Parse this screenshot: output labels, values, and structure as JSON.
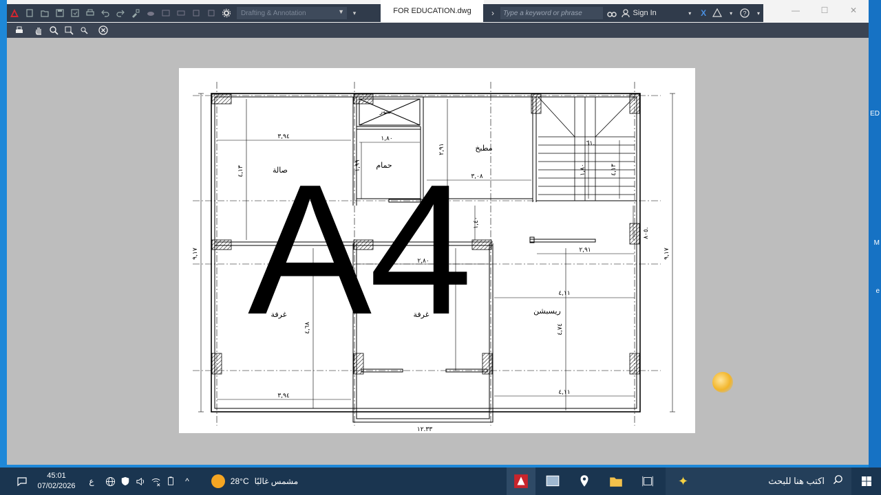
{
  "titlebar": {
    "workspace_placeholder": "Drafting & Annotation",
    "document_tab": "FOR EDUCATION.dwg",
    "search_placeholder": "Type a keyword or phrase",
    "signin_label": "Sign In",
    "qat_icons": [
      "autocad-logo-icon",
      "new-icon",
      "open-icon",
      "save-icon",
      "save-as-icon",
      "print-icon",
      "undo-icon",
      "redo-icon",
      "match-properties-icon",
      "plot-icon",
      "workspace-gear-icon"
    ]
  },
  "toolbar": {
    "icons": [
      "print-icon",
      "pan-hand-icon",
      "zoom-icon",
      "zoom-window-icon",
      "zoom-previous-icon",
      "close-preview-icon"
    ]
  },
  "drawing": {
    "paper_label": "A4",
    "rooms": {
      "living": "صالة",
      "bath": "حمام",
      "kitchen": "مطبخ",
      "shaft": "منور",
      "room1": "غرفة",
      "room2": "غرفة",
      "reception": "ريسبشن"
    },
    "dims": {
      "living_w": "٣,٩٤",
      "living_h": "٤,١٣",
      "bath_w": "١,٨٠",
      "bath_h": "١,٩٩",
      "kitchen_h": "٢,٩١",
      "kitchen_w": "٣,٠٨",
      "stair_w": "٦١.",
      "stair_h": "١,٨٠",
      "stair_right": "٤,١٣",
      "right_mid": "٨٠٥.",
      "corridor_h": "١,٤٠",
      "corridor_w": "٢,٨٠",
      "recep_top": "٢,٩١",
      "recep_w": "٤,١١",
      "recep_h": "٤,٧٤",
      "room1_h": "٤,٦٨",
      "bottom_left": "٣,٩٤",
      "bottom_right": "٤,١١",
      "total_w": "١٢.٣٣",
      "left_total": "٩,١٧",
      "right_total": "٩,١٧"
    }
  },
  "taskbar": {
    "time": "45:01",
    "date": "07/02/2026",
    "lang": "ع",
    "weather_temp": "28°C",
    "weather_text": "مشمس غالبًا",
    "search_placeholder": "اكتب هنا للبحث"
  },
  "desktop_edge_text": [
    "ED",
    "M",
    "e"
  ]
}
